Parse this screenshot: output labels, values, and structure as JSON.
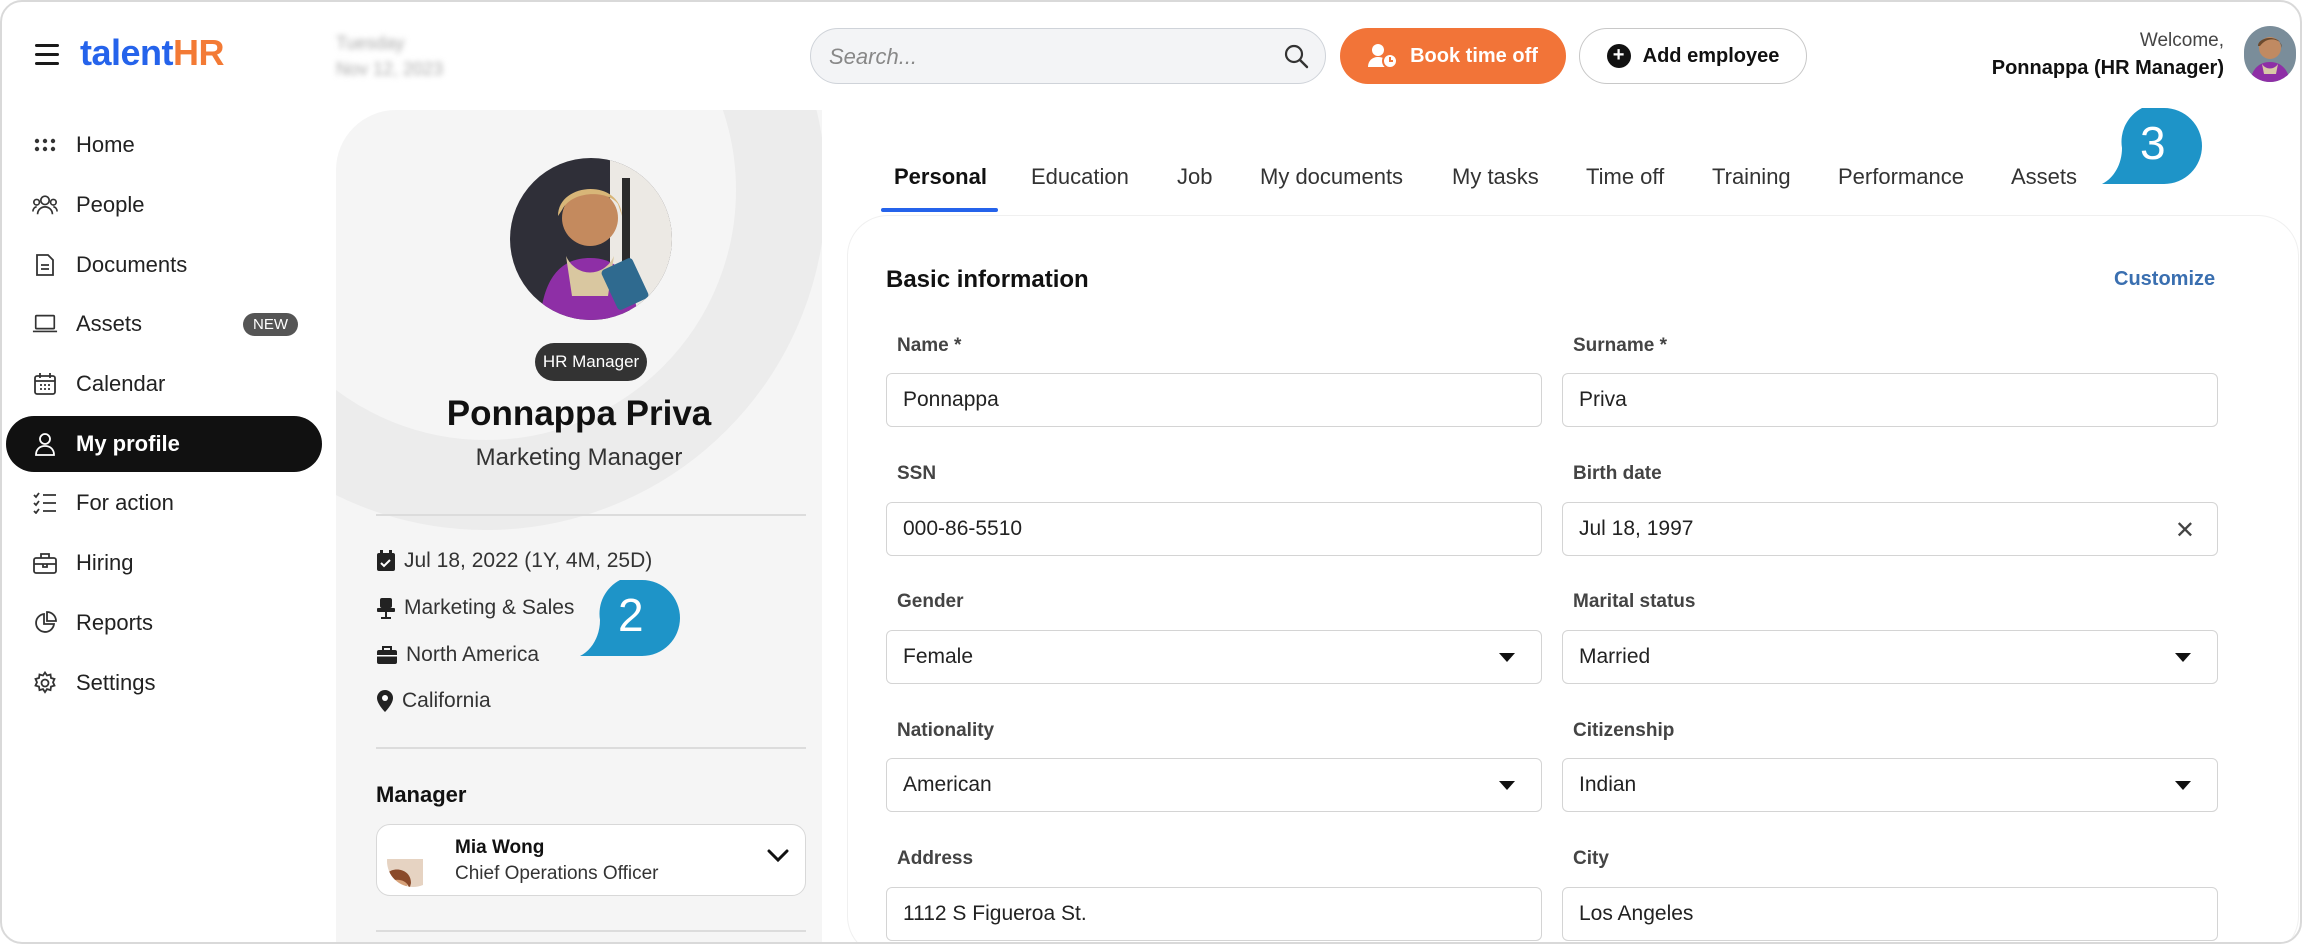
{
  "header": {
    "logo_part1": "talent",
    "logo_part2": "HR",
    "date_blurred_line1": "Tuesday",
    "date_blurred_line2": "Nov 12, 2023",
    "search_placeholder": "Search...",
    "book_time_off_label": "Book time off",
    "add_employee_label": "Add employee",
    "welcome_text": "Welcome,",
    "user_name": "Ponnappa (HR Manager)"
  },
  "sidebar": {
    "items": [
      {
        "label": "Home",
        "icon": "grid-icon"
      },
      {
        "label": "People",
        "icon": "people-icon"
      },
      {
        "label": "Documents",
        "icon": "document-icon"
      },
      {
        "label": "Assets",
        "icon": "laptop-icon",
        "badge": "NEW"
      },
      {
        "label": "Calendar",
        "icon": "calendar-icon"
      },
      {
        "label": "My profile",
        "icon": "user-icon",
        "active": true
      },
      {
        "label": "For action",
        "icon": "checklist-icon"
      },
      {
        "label": "Hiring",
        "icon": "briefcase-icon"
      },
      {
        "label": "Reports",
        "icon": "pie-chart-icon"
      },
      {
        "label": "Settings",
        "icon": "gear-icon"
      }
    ]
  },
  "profile": {
    "role_badge": "HR Manager",
    "name": "Ponnappa Priva",
    "title": "Marketing Manager",
    "start_date": "Jul 18, 2022 (1Y, 4M, 25D)",
    "department": "Marketing & Sales",
    "region": "North America",
    "location": "California",
    "manager_label": "Manager",
    "manager_name": "Mia Wong",
    "manager_title": "Chief Operations Officer"
  },
  "callouts": {
    "profile_callout": "2",
    "tabs_callout": "3"
  },
  "tabs": [
    "Personal",
    "Education",
    "Job",
    "My documents",
    "My tasks",
    "Time off",
    "Training",
    "Performance",
    "Assets"
  ],
  "active_tab": "Personal",
  "basic_info": {
    "title": "Basic information",
    "customize_label": "Customize",
    "fields": {
      "name": {
        "label": "Name *",
        "value": "Ponnappa"
      },
      "surname": {
        "label": "Surname *",
        "value": "Priva"
      },
      "ssn": {
        "label": "SSN",
        "value": "000-86-5510"
      },
      "birth_date": {
        "label": "Birth date",
        "value": "Jul 18, 1997"
      },
      "gender": {
        "label": "Gender",
        "value": "Female"
      },
      "marital_status": {
        "label": "Marital status",
        "value": "Married"
      },
      "nationality": {
        "label": "Nationality",
        "value": "American"
      },
      "citizenship": {
        "label": "Citizenship",
        "value": "Indian"
      },
      "address": {
        "label": "Address",
        "value": "1112 S Figueroa St."
      },
      "city": {
        "label": "City",
        "value": "Los Angeles"
      }
    }
  },
  "colors": {
    "accent_orange": "#f27438",
    "accent_blue": "#2563eb",
    "callout_blue": "#1e94c8"
  }
}
